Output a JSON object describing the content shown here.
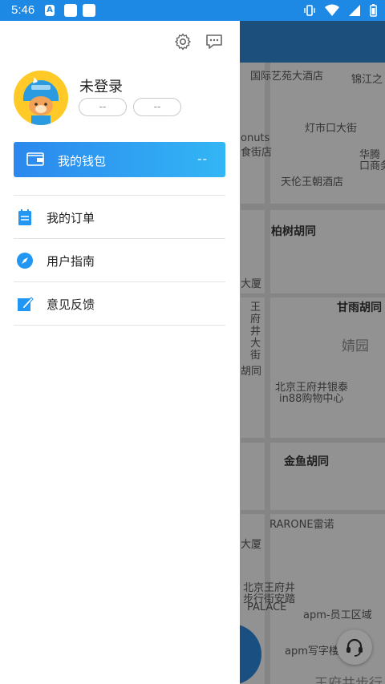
{
  "status_bar": {
    "time": "5:46",
    "notif_letter": "A"
  },
  "map": {
    "labels": [
      "国际艺苑大酒店",
      "锦江之",
      "灯市口大街",
      "onuts",
      "食街店",
      "华腾",
      "口商务",
      "天伦王朝酒店",
      "柏树胡同",
      "大厦",
      "王",
      "府",
      "井",
      "大",
      "街",
      "甘雨胡同",
      "婧园",
      "胡同",
      "北京王府井银泰",
      "in88购物中心",
      "金鱼胡同",
      "RARONE雷诺",
      "大厦",
      "北京王府井",
      "步行街安踏",
      "PALACE",
      "apm-员工区域",
      "apm写字楼",
      "王府井步行"
    ]
  },
  "drawer": {
    "user": {
      "name": "未登录",
      "stat1": "--",
      "stat2": "--"
    },
    "wallet": {
      "label": "我的钱包",
      "value": "--"
    },
    "menu": [
      {
        "label": "我的订单",
        "icon": "order-icon"
      },
      {
        "label": "用户指南",
        "icon": "compass-icon"
      },
      {
        "label": "意见反馈",
        "icon": "feedback-icon"
      }
    ]
  },
  "colors": {
    "primary": "#1e88e5",
    "wallet_gradient_start": "#2b88ee",
    "wallet_gradient_end": "#33b6f5",
    "icon_blue": "#2196f3"
  }
}
